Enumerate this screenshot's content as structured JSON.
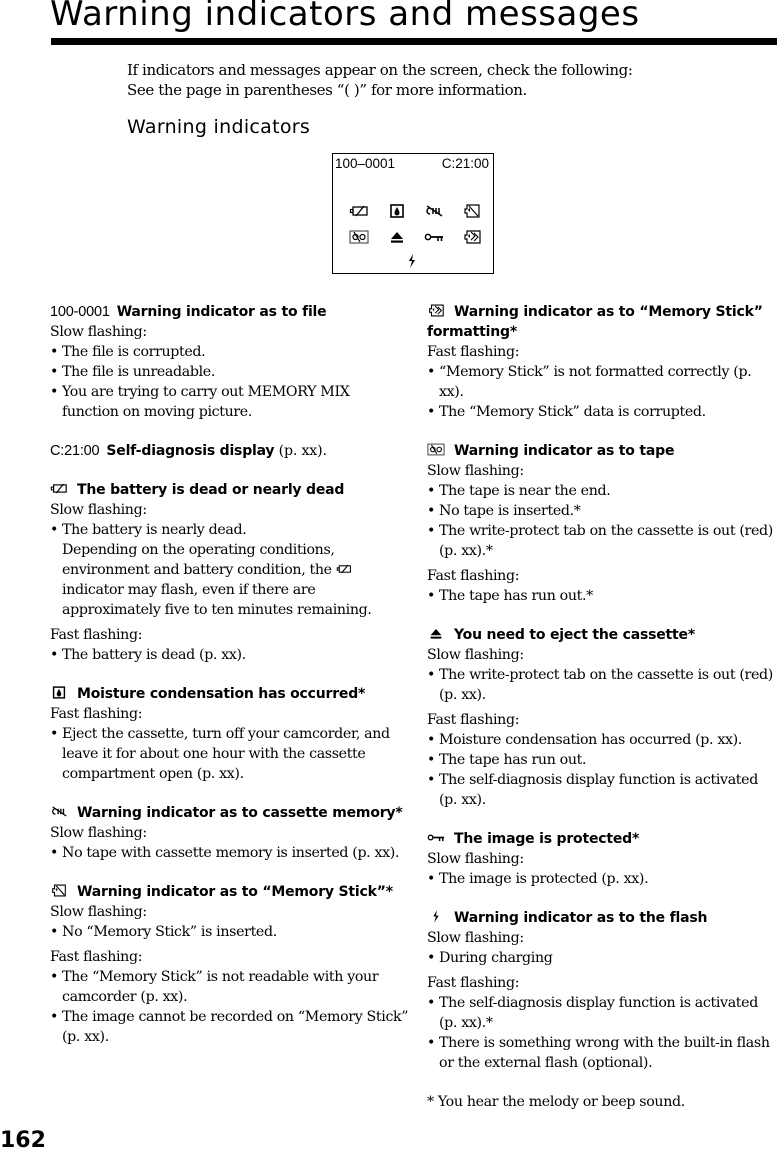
{
  "page": {
    "title": "Warning indicators and messages",
    "intro": [
      "If indicators and messages appear on the screen, check the following:",
      "See the page in parentheses “(    )” for more information."
    ],
    "subtitle": "Warning indicators",
    "page_number": "162"
  },
  "screen": {
    "file_number": "100–0001",
    "self_diagnosis": "C:21:00",
    "icons_row1": [
      "battery-warning-icon",
      "moisture-icon",
      "cassette-memory-icon",
      "memory-stick-icon"
    ],
    "icons_row2": [
      "tape-warning-icon",
      "eject-icon",
      "protect-key-icon",
      "memory-stick-format-icon"
    ],
    "icons_row3": [
      "flash-icon"
    ]
  },
  "left_column": [
    {
      "code": "100-0001",
      "heading": "Warning indicator as to file",
      "groups": [
        {
          "label": "Slow flashing:",
          "items": [
            "The file is corrupted.",
            "The file is unreadable.",
            "You are trying to carry out MEMORY MIX function on moving picture."
          ]
        }
      ]
    },
    {
      "code": "C:21:00",
      "heading": "Self-diagnosis display",
      "ref": " (p. xx)."
    },
    {
      "icon": "battery-warning-icon",
      "heading": "The battery is dead or nearly dead",
      "groups": [
        {
          "label": "Slow flashing:",
          "items": [
            "The battery is nearly dead."
          ],
          "note_before": "Depending on the operating conditions, environment and battery condition, the",
          "note_after": "indicator may flash, even if there are approximately five to ten minutes remaining."
        },
        {
          "label": "Fast flashing:",
          "items": [
            "The battery is dead (p. xx)."
          ]
        }
      ]
    },
    {
      "icon": "moisture-icon",
      "heading": "Moisture condensation has occurred*",
      "groups": [
        {
          "label": "Fast flashing:",
          "items": [
            "Eject the cassette, turn off your camcorder, and leave it for about one hour with the cassette compartment open (p. xx)."
          ]
        }
      ]
    },
    {
      "icon": "cassette-memory-icon",
      "heading": "Warning indicator as to cassette memory*",
      "groups": [
        {
          "label": "Slow flashing:",
          "items": [
            "No tape with cassette memory is inserted (p. xx)."
          ]
        }
      ]
    },
    {
      "icon": "memory-stick-icon",
      "heading": "Warning indicator as to “Memory Stick”*",
      "groups": [
        {
          "label": "Slow flashing:",
          "items": [
            "No “Memory Stick” is inserted."
          ]
        },
        {
          "label": "Fast flashing:",
          "items": [
            "The “Memory Stick” is not readable with your camcorder (p. xx).",
            "The image cannot be recorded on “Memory Stick” (p. xx)."
          ]
        }
      ]
    }
  ],
  "right_column": [
    {
      "icon": "memory-stick-format-icon",
      "heading": "Warning indicator as to “Memory Stick” formatting*",
      "groups": [
        {
          "label": "Fast flashing:",
          "items": [
            "“Memory Stick” is not formatted correctly (p. xx).",
            "The “Memory Stick” data is corrupted."
          ]
        }
      ]
    },
    {
      "icon": "tape-warning-icon",
      "heading": "Warning indicator as to tape",
      "groups": [
        {
          "label": "Slow flashing:",
          "items": [
            "The tape is near the end.",
            "No tape is inserted.*",
            "The write-protect tab on the cassette is out (red) (p. xx).*"
          ]
        },
        {
          "label": "Fast flashing:",
          "items": [
            "The tape has run out.*"
          ]
        }
      ]
    },
    {
      "icon": "eject-icon",
      "heading": "You need to eject the cassette*",
      "groups": [
        {
          "label": "Slow flashing:",
          "items": [
            "The write-protect tab on the cassette is out (red) (p. xx)."
          ]
        },
        {
          "label": "Fast flashing:",
          "items": [
            "Moisture condensation has occurred (p. xx).",
            "The tape has run out.",
            "The self-diagnosis display function is activated (p. xx)."
          ]
        }
      ]
    },
    {
      "icon": "protect-key-icon",
      "heading": "The image is protected*",
      "groups": [
        {
          "label": "Slow flashing:",
          "items": [
            "The image is protected (p. xx)."
          ]
        }
      ]
    },
    {
      "icon": "flash-icon",
      "heading": "Warning indicator as to the flash",
      "groups": [
        {
          "label": "Slow flashing:",
          "items": [
            "During charging"
          ]
        },
        {
          "label": "Fast flashing:",
          "items": [
            "The self-diagnosis display function is activated (p. xx).*",
            "There is something wrong with the built-in flash or the external flash (optional)."
          ]
        }
      ]
    }
  ],
  "footnote": "* You hear the melody or beep sound."
}
